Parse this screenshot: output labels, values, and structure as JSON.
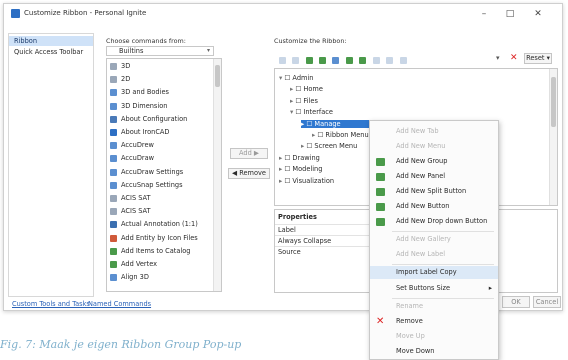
{
  "window": {
    "title": "Customize Ribbon - Personal Ignite",
    "controls": [
      "minimize",
      "maximize",
      "close"
    ]
  },
  "left_nav": {
    "items": [
      {
        "label": "Ribbon",
        "selected": true
      },
      {
        "label": "Quick Access Toolbar",
        "selected": false
      }
    ]
  },
  "choose": {
    "label": "Choose commands from:",
    "selected": "Builtins",
    "items": [
      "3D",
      "2D",
      "3D and Bodies",
      "3D Dimension",
      "About Configuration",
      "About IronCAD",
      "AccuDrew",
      "AccuDraw",
      "AccuDraw Settings",
      "AccuSnap Settings",
      "ACIS SAT",
      "ACIS SAT",
      "Actual Annotation (1:1)",
      "Add Entity by Icon Files",
      "Add Items to Catalog",
      "Add Vertex",
      "Align 3D"
    ]
  },
  "move_buttons": {
    "add": "Add",
    "remove": "Remove"
  },
  "customize": {
    "label": "Customize the Ribbon:",
    "reset_label": "Reset"
  },
  "tree": [
    {
      "label": "Admin",
      "level": 0,
      "expanded": true
    },
    {
      "label": "Home",
      "level": 1
    },
    {
      "label": "Files",
      "level": 1
    },
    {
      "label": "Interface",
      "level": 1,
      "expanded": true
    },
    {
      "label": "Manage",
      "level": 2,
      "selected": true
    },
    {
      "label": "Ribbon Menu",
      "level": 3
    },
    {
      "label": "Screen Menu",
      "level": 2
    },
    {
      "label": "Drawing",
      "level": 0
    },
    {
      "label": "Modeling",
      "level": 0
    },
    {
      "label": "Visualization",
      "level": 0
    }
  ],
  "properties": {
    "header": "Properties",
    "rows": [
      "Label",
      "Always Collapse",
      "Source"
    ]
  },
  "footer": {
    "links": [
      "Custom Tools and Tasks",
      "Named Commands"
    ],
    "ok": "OK",
    "cancel": "Cancel"
  },
  "context_menu": {
    "items": [
      {
        "label": "Add New Tab",
        "disabled": true
      },
      {
        "label": "Add New Menu",
        "disabled": true
      },
      {
        "label": "Add New Group",
        "disabled": false
      },
      {
        "label": "Add New Panel",
        "disabled": false
      },
      {
        "label": "Add New Split Button",
        "disabled": false
      },
      {
        "label": "Add New Button",
        "disabled": false
      },
      {
        "label": "Add New Drop down Button",
        "disabled": false
      },
      {
        "label": "Add New Gallery",
        "disabled": true
      },
      {
        "label": "Add New Label",
        "disabled": true
      },
      {
        "label": "Import Label Copy",
        "disabled": false,
        "highlight": true
      },
      {
        "label": "Set Buttons Size",
        "disabled": false,
        "submenu": true
      },
      {
        "label": "Rename",
        "disabled": true
      },
      {
        "label": "Remove",
        "disabled": false
      },
      {
        "label": "Move Up",
        "disabled": true
      },
      {
        "label": "Move Down",
        "disabled": false
      }
    ]
  },
  "caption": "Fig. 7: Maak je eigen Ribbon Group Pop-up",
  "colors": {
    "accent": "#2d6fc4",
    "selection": "#cfe2f8",
    "caption": "#7fb0cc"
  }
}
